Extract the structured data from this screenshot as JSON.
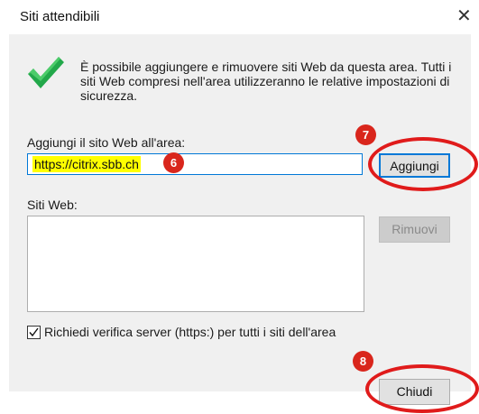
{
  "dialog": {
    "title": "Siti attendibili",
    "close_glyph": "✕",
    "info_text": "È possibile aggiungere e rimuovere siti Web da questa area. Tutti i siti Web compresi nell'area utilizzeranno le relative impostazioni di sicurezza.",
    "info_icon": "green-checkmark-icon"
  },
  "add_section": {
    "label": "Aggiungi il sito Web all'area:",
    "url_value": "https://citrix.sbb.ch",
    "add_button": "Aggiungi"
  },
  "sites_section": {
    "label": "Siti Web:",
    "items": [],
    "remove_button": "Rimuovi"
  },
  "verify": {
    "checked": true,
    "label": "Richiedi verifica server (https:) per tutti i siti dell'area"
  },
  "footer": {
    "close_button": "Chiudi"
  },
  "annotations": {
    "step_6": "6",
    "step_7": "7",
    "step_8": "8",
    "badge_color": "#d9261c",
    "ellipse_color": "#e01b1b",
    "highlight_color": "#ffff00"
  }
}
